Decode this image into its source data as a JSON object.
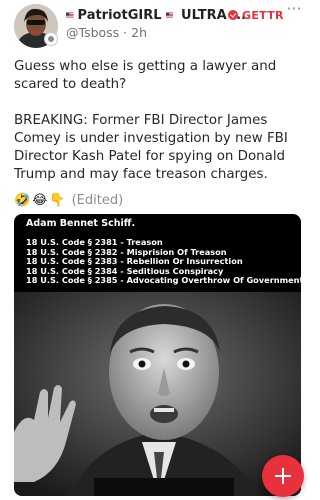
{
  "author": {
    "display_name": "PatriotGIRL",
    "name_suffix": "ULTRA ...",
    "handle": "@Tsboss",
    "separator": "·",
    "time": "2h",
    "flag_icon": "us-flag-icon",
    "avatar_icon": "profile-avatar"
  },
  "source": {
    "label": "GETTR",
    "icon": "gettr-logo-icon",
    "color": "#e8313c"
  },
  "menu": {
    "icon": "more-horizontal-icon"
  },
  "post": {
    "paragraph_1": "Guess who else is getting a lawyer and scared to death?",
    "paragraph_2": "BREAKING: Former FBI Director James Comey is under investigation by new FBI Director Kash Patel for spying on Donald Trump and may face treason charges."
  },
  "reactions": {
    "emojis": [
      "🤣",
      "😂",
      "👇"
    ],
    "edited_label": "(Edited)"
  },
  "media": {
    "caption": "Adam Bennet Schiff.",
    "codes": [
      "18 U.S. Code § 2381 - Treason",
      "18 U.S. Code § 2382 - Misprision Of Treason",
      "18 U.S. Code § 2383 - Rebellion Or Insurrection",
      "18 U.S. Code § 2384 - Seditious Conspiracy",
      "18 U.S. Code § 2385 - Advocating Overthrow Of Government"
    ]
  },
  "fab": {
    "icon": "plus-icon",
    "color": "#e8313c"
  }
}
